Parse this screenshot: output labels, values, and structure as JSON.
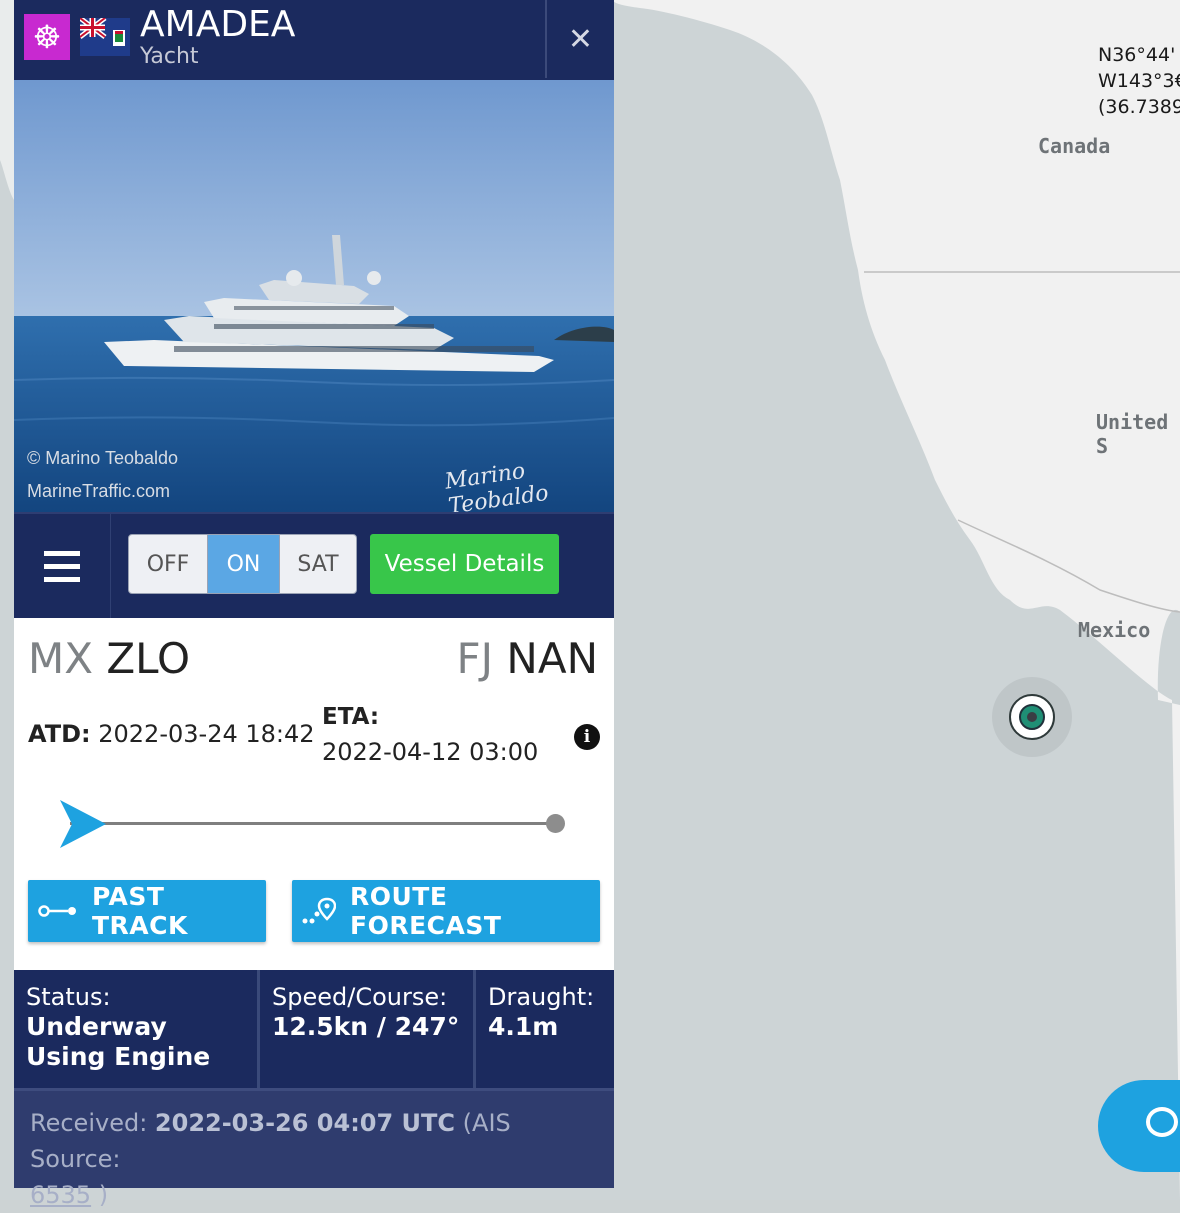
{
  "map": {
    "coordinates": [
      "N36°44'",
      "W143°3€",
      "(36.7389"
    ],
    "labels": {
      "canada": "Canada",
      "united_states": "United S",
      "mexico": "Mexico"
    },
    "colors": {
      "water": "#cdd4d6",
      "land": "#f1f1f1",
      "marker": "#1f8f75"
    }
  },
  "vessel": {
    "name": "AMADEA",
    "type": "Yacht",
    "type_icon": "ship-wheel-icon",
    "flag_icon": "cayman-islands-flag-icon"
  },
  "photo": {
    "credit_line1": "© Marino Teobaldo",
    "credit_line2": "MarineTraffic.com",
    "signature": "Marino Teobaldo"
  },
  "controls": {
    "off_label": "OFF",
    "on_label": "ON",
    "sat_label": "SAT",
    "selected": "ON",
    "details_label": "Vessel Details",
    "menu_icon": "hamburger-menu-icon"
  },
  "voyage": {
    "from": {
      "country": "MX",
      "port": "ZLO"
    },
    "to": {
      "country": "FJ",
      "port": "NAN"
    },
    "atd_label": "ATD:",
    "atd_value": "2022-03-24 18:42",
    "eta_label": "ETA:",
    "eta_value": "2022-04-12 03:00",
    "progress": 0.0
  },
  "actions": {
    "past_track": "PAST TRACK",
    "route_forecast": "ROUTE FORECAST"
  },
  "stats": {
    "status_label": "Status:",
    "status_line1": "Underway",
    "status_line2": "Using Engine",
    "speed_label": "Speed/Course:",
    "speed_value": "12.5kn / 247°",
    "draught_label": "Draught:",
    "draught_value": "4.1m"
  },
  "received": {
    "label": "Received:",
    "value": "2022-03-26 04:07 UTC",
    "source_prefix": "(AIS Source:",
    "source_id": "6535",
    "source_suffix": ")"
  },
  "colors": {
    "header": "#1b2a5e",
    "accent_blue": "#1ea2e0",
    "green": "#38c64a",
    "toggle_on": "#5ba7e4"
  }
}
